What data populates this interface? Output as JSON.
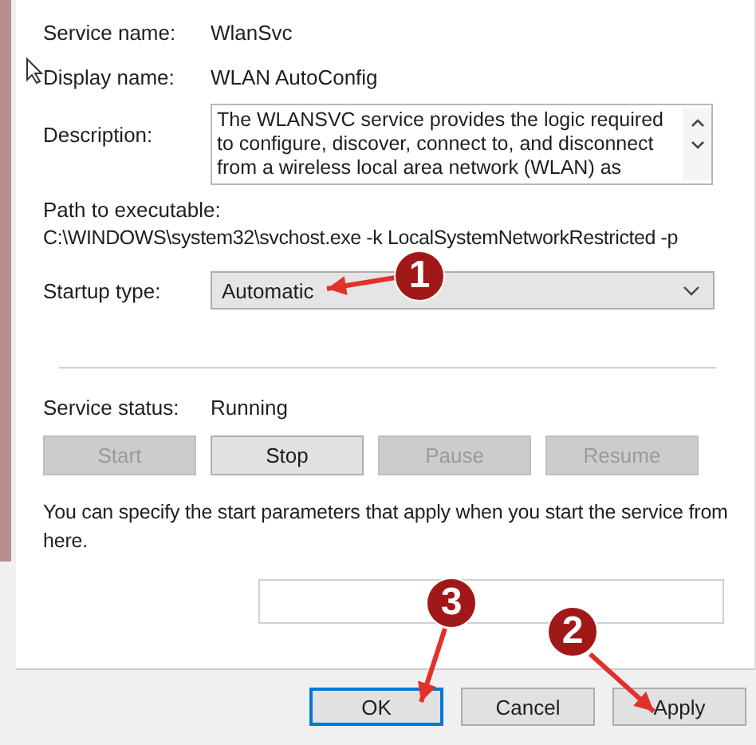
{
  "fields": [
    {
      "label": "Service name:",
      "value": "WlanSvc"
    },
    {
      "label": "Display name:",
      "value": "WLAN AutoConfig"
    }
  ],
  "description": {
    "label": "Description:",
    "text": "The WLANSVC service provides the logic required to configure, discover, connect to, and disconnect from a wireless local area network (WLAN) as"
  },
  "path": {
    "label": "Path to executable:",
    "value": "C:\\WINDOWS\\system32\\svchost.exe -k LocalSystemNetworkRestricted -p"
  },
  "startup_type": {
    "label": "Startup type:",
    "value": "Automatic"
  },
  "service_status": {
    "label": "Service status:",
    "value": "Running"
  },
  "service_buttons": [
    {
      "label": "Start",
      "disabled": true
    },
    {
      "label": "Stop",
      "disabled": false
    },
    {
      "label": "Pause",
      "disabled": true
    },
    {
      "label": "Resume",
      "disabled": true
    }
  ],
  "hint": "You can specify the start parameters that apply when you start the service from here.",
  "dialog_buttons": [
    {
      "label": "OK",
      "default": true
    },
    {
      "label": "Cancel",
      "default": false
    },
    {
      "label": "Apply",
      "default": false
    }
  ],
  "annotations": [
    {
      "label": "1"
    },
    {
      "label": "2"
    },
    {
      "label": "3"
    }
  ]
}
